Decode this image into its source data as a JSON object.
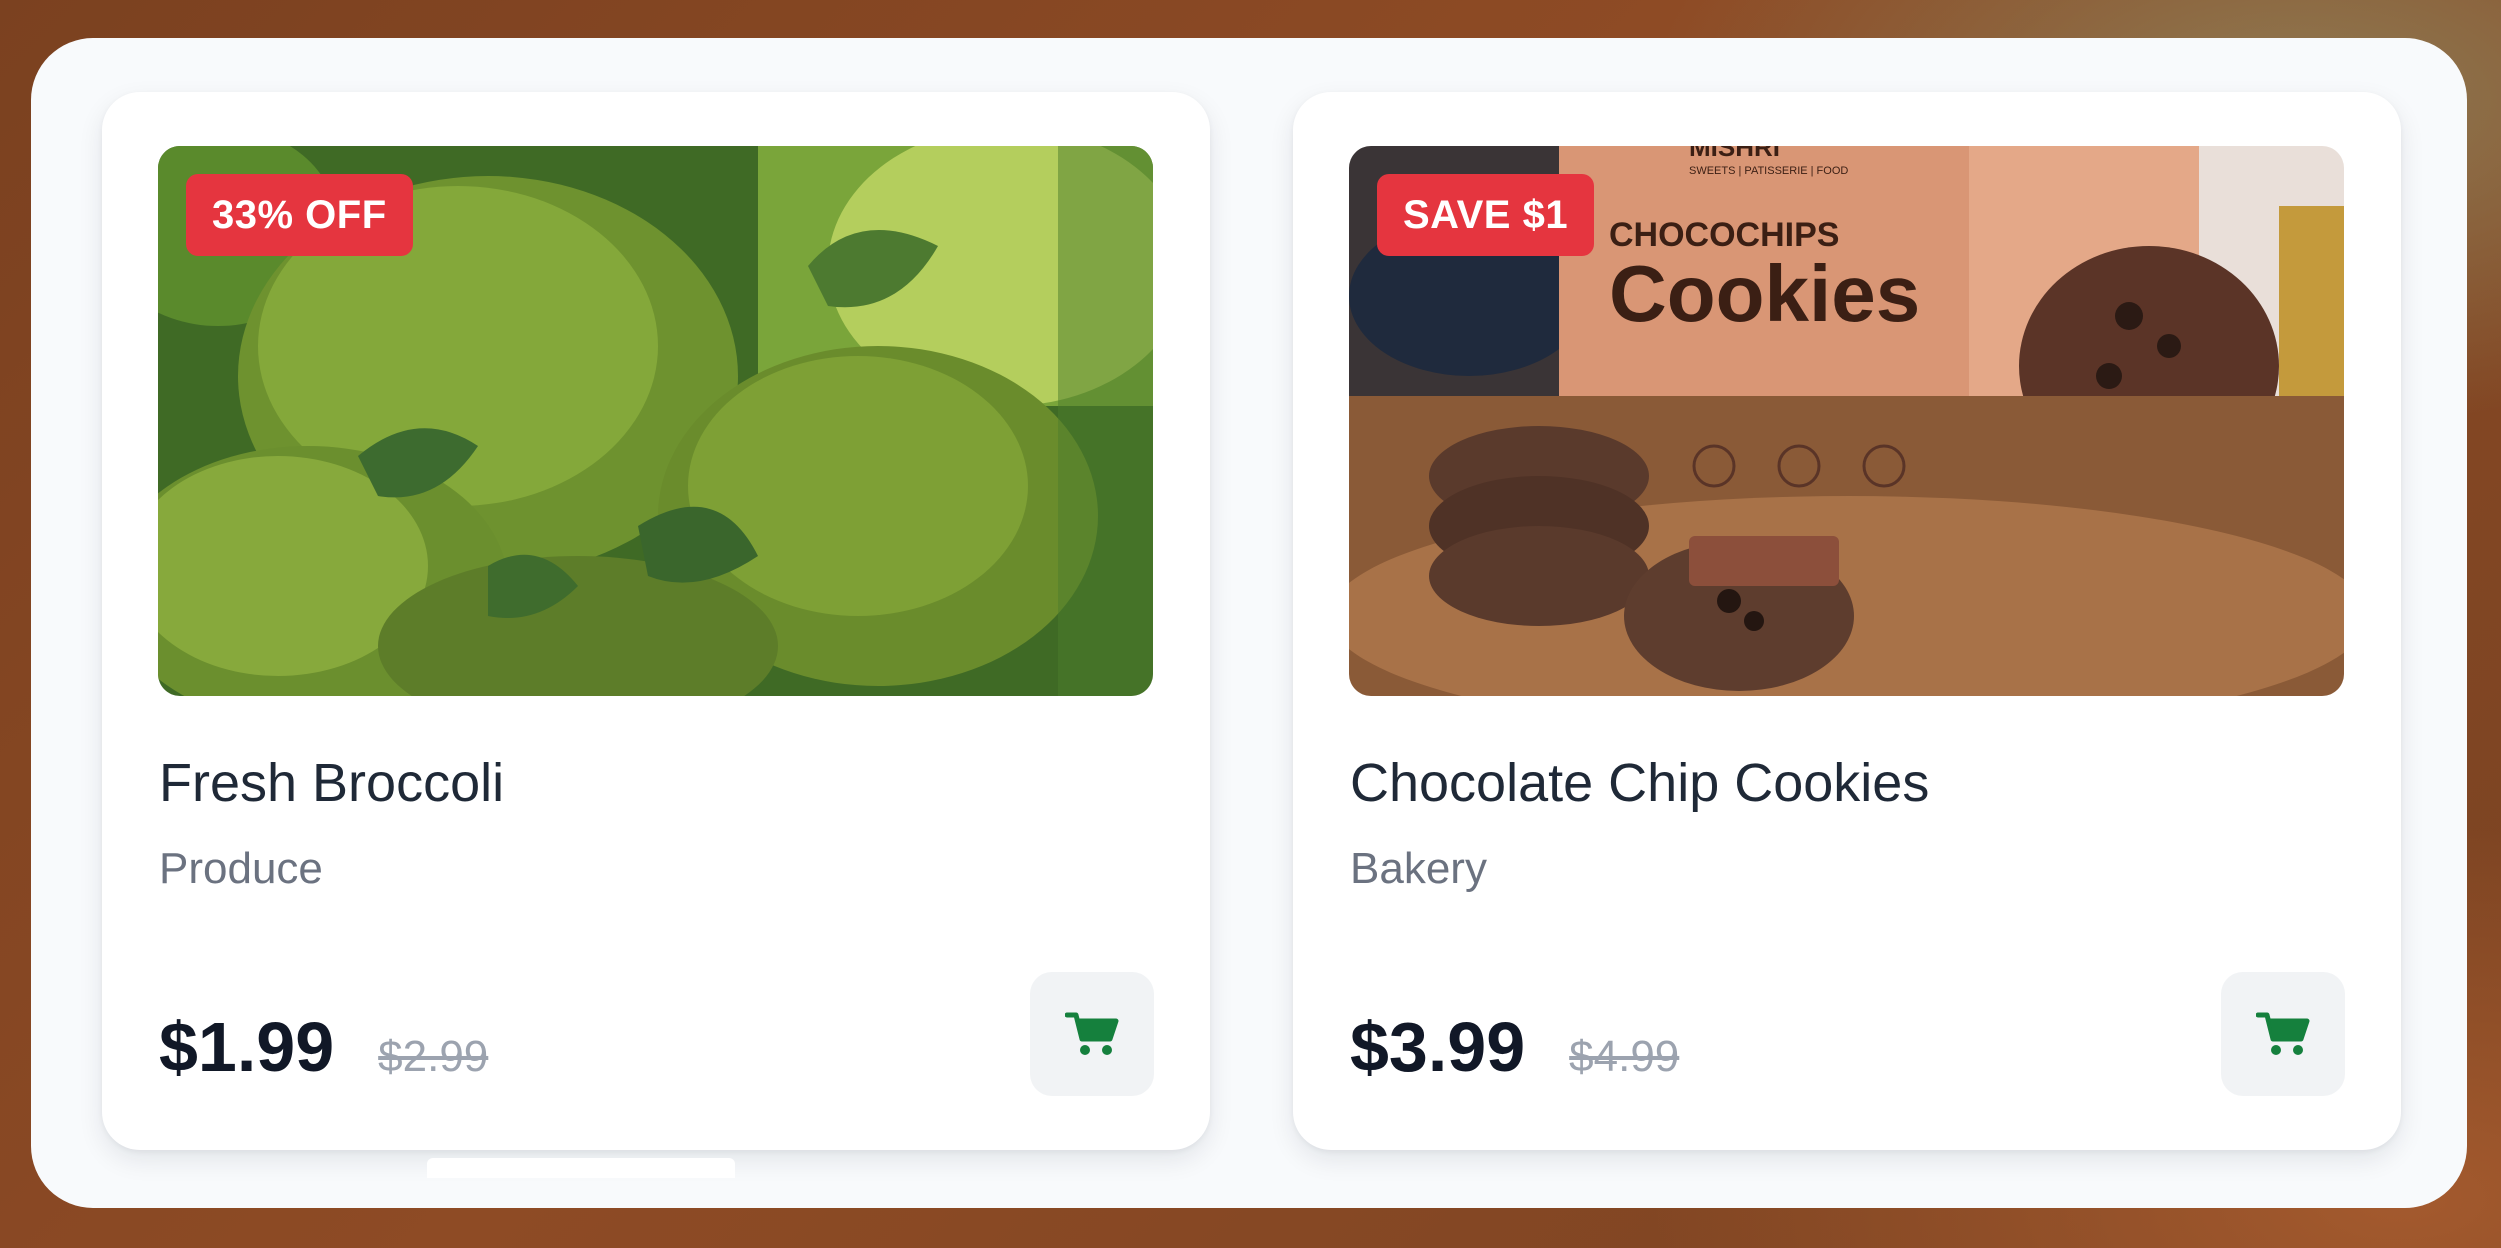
{
  "products": [
    {
      "name": "Fresh Broccoli",
      "category": "Produce",
      "badge": "33% OFF",
      "price": "$1.99",
      "original_price": "$2.99",
      "image": "broccoli-photo"
    },
    {
      "name": "Chocolate Chip Cookies",
      "category": "Bakery",
      "badge": "SAVE $1",
      "price": "$3.99",
      "original_price": "$4.99",
      "image": "cookies-photo",
      "image_text": {
        "brand": "MISHRI",
        "tagline": "SWEETS | PATISSERIE | FOOD",
        "line1": "CHOCOCHIPS",
        "line2": "Cookies"
      }
    }
  ],
  "colors": {
    "badge": "#e5353f",
    "cart_icon": "#15803d",
    "price": "#111827",
    "muted": "#9ca3af"
  },
  "icons": {
    "cart": "shopping-cart-icon"
  }
}
